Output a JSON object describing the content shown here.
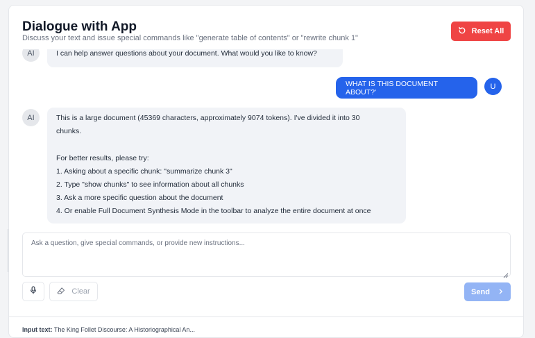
{
  "header": {
    "title": "Dialogue with App",
    "subtitle": "Discuss your text and issue special commands like \"generate table of contents\" or \"rewrite chunk 1\"",
    "reset_label": "Reset All"
  },
  "messages": {
    "ai_first": "I can help answer questions about your document. What would you like to know?",
    "ai_first_avatar": "AI",
    "user_text": "WHAT IS THIS DOCUMENT ABOUT?'",
    "user_avatar": "U",
    "ai_second_avatar": "AI",
    "ai_second_lines": [
      "This is a large document (45369 characters, approximately 9074 tokens). I've divided it into 30",
      "chunks.",
      "",
      "For better results, please try:",
      "1. Asking about a specific chunk: \"summarize chunk 3\"",
      "2. Type \"show chunks\" to see information about all chunks",
      "3. Ask a more specific question about the document",
      "4. Or enable Full Document Synthesis Mode in the toolbar to analyze the entire document at once"
    ]
  },
  "input": {
    "placeholder": "Ask a question, give special commands, or provide new instructions...",
    "value": ""
  },
  "controls": {
    "clear_label": "Clear",
    "send_label": "Send"
  },
  "footer": {
    "label": "Input text:",
    "value": "The King Follet Discourse: A Historiographical An..."
  },
  "colors": {
    "accent": "#2563eb",
    "danger": "#ef4444",
    "send_disabled": "#93b4f5",
    "bubble_ai": "#f1f3f7"
  },
  "icons": {
    "reset": "refresh-icon",
    "mic": "microphone-icon",
    "clear": "eraser-icon",
    "send": "chevron-right-icon"
  }
}
